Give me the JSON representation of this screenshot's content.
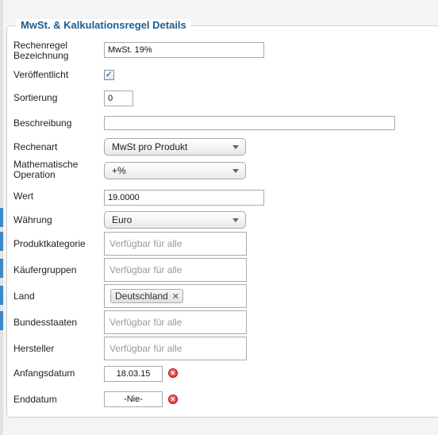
{
  "panel": {
    "legend": "MwSt. & Kalkulationsregel Details"
  },
  "fields": {
    "name": {
      "label": "Rechenregel Bezeichnung",
      "value": "MwSt. 19%"
    },
    "published": {
      "label": "Veröffentlicht",
      "checked": true,
      "check_glyph": "✓"
    },
    "ordering": {
      "label": "Sortierung",
      "value": "0"
    },
    "description": {
      "label": "Beschreibung",
      "value": ""
    },
    "kind": {
      "label": "Rechenart",
      "selected": "MwSt pro Produkt"
    },
    "operation": {
      "label": "Mathematische Operation",
      "selected": "+%"
    },
    "value": {
      "label": "Wert",
      "value": "19.0000"
    },
    "currency": {
      "label": "Währung",
      "selected": "Euro"
    },
    "category": {
      "label": "Produktkategorie",
      "placeholder": "Verfügbar für alle"
    },
    "shoppergroups": {
      "label": "Käufergruppen",
      "placeholder": "Verfügbar für alle"
    },
    "country": {
      "label": "Land",
      "chip": "Deutschland",
      "chip_remove": "✕"
    },
    "states": {
      "label": "Bundesstaaten",
      "placeholder": "Verfügbar für alle"
    },
    "manufacturer": {
      "label": "Hersteller",
      "placeholder": "Verfügbar für alle"
    },
    "start_date": {
      "label": "Anfangsdatum",
      "value": "18.03.15"
    },
    "end_date": {
      "label": "Enddatum",
      "value": "-Nie-"
    }
  },
  "icons": {
    "clear": "clear-icon",
    "dropdown": "chevron-down-icon",
    "remove": "close-icon"
  },
  "colors": {
    "legend": "#1d5c8f",
    "accent_edge": "#3b87c7",
    "clear_button": "#d21d1d"
  }
}
